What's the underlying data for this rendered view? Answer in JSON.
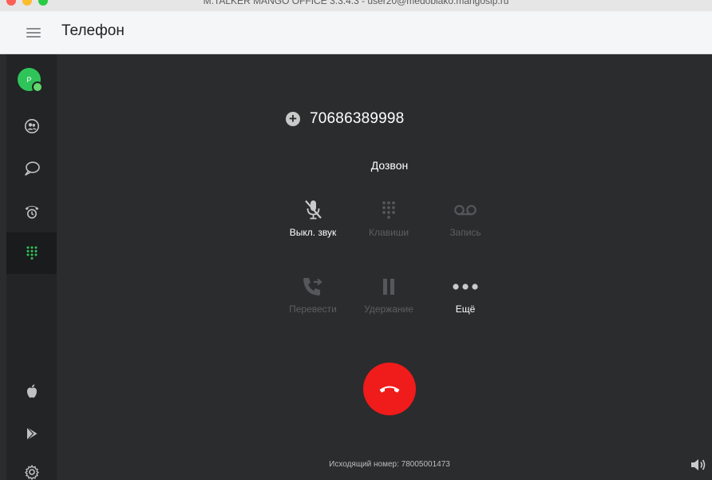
{
  "window": {
    "title": "M.TALKER MANGO OFFICE 3.3.4.3 - user20@medoblako.mangosip.ru"
  },
  "header": {
    "title": "Телефон"
  },
  "sidebar": {
    "avatar_initial": "P",
    "items": [
      {
        "name": "contacts",
        "icon": "contacts-icon"
      },
      {
        "name": "chats",
        "icon": "chat-icon"
      },
      {
        "name": "call-history",
        "icon": "phone-clock-icon"
      },
      {
        "name": "dialpad",
        "icon": "dialpad-icon",
        "active": true
      },
      {
        "name": "apple-store",
        "icon": "apple-icon"
      },
      {
        "name": "google-play",
        "icon": "play-icon"
      },
      {
        "name": "settings",
        "icon": "gear-icon"
      }
    ]
  },
  "call": {
    "number": "70686389998",
    "status": "Дозвон",
    "outgoing_number": "Исходящий номер: 78005001473"
  },
  "controls": {
    "mute": "Выкл. звук",
    "keypad": "Клавиши",
    "record": "Запись",
    "transfer": "Перевести",
    "hold": "Удержание",
    "more": "Ещё"
  },
  "colors": {
    "accent": "#2fc45a",
    "hangup": "#f01b1b",
    "background": "#2b2c2d",
    "sidebar": "#222425",
    "disabled": "#5c5f61"
  }
}
